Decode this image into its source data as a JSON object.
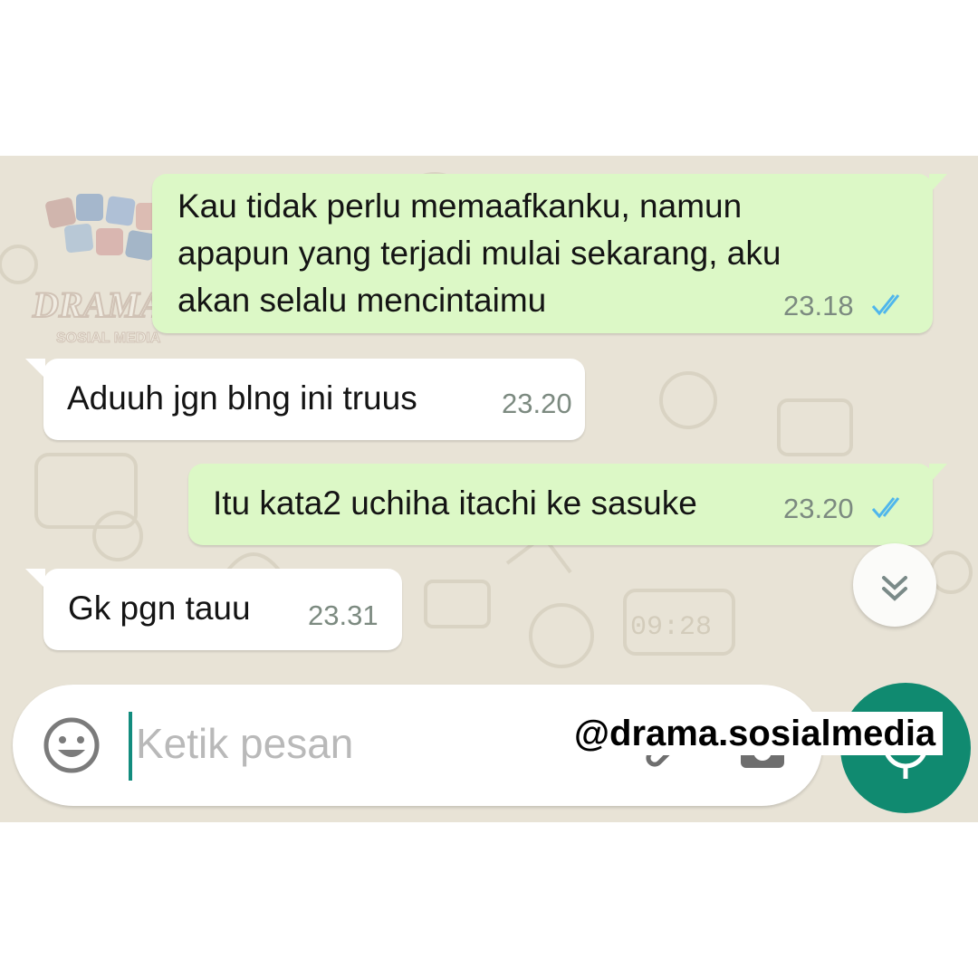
{
  "messages": [
    {
      "direction": "outgoing",
      "text": "Kau tidak perlu memaafkanku, namun\napapun yang terjadi mulai sekarang, aku\nakan selalu mencintaimu",
      "time": "23.18",
      "status": "read"
    },
    {
      "direction": "incoming",
      "text": "Aduuh jgn blng ini truus",
      "time": "23.20"
    },
    {
      "direction": "outgoing",
      "text": "Itu kata2 uchiha itachi ke sasuke",
      "time": "23.20",
      "status": "read"
    },
    {
      "direction": "incoming",
      "text": "Gk pgn tauu",
      "time": "23.31"
    }
  ],
  "input": {
    "placeholder": "Ketik pesan"
  },
  "icons": {
    "emoji": "emoji-icon",
    "attach": "paperclip-icon",
    "camera": "camera-icon",
    "send": "microphone-icon",
    "scroll": "chevron-double-down-icon",
    "read": "double-check-icon"
  },
  "watermark": "@drama.sosialmedia",
  "logo_text": "DRAMA SOSIAL MEDIA",
  "colors": {
    "wallpaper": "#e8e3d6",
    "outgoing_bubble": "#dcf8c6",
    "incoming_bubble": "#ffffff",
    "read_ticks": "#4fb6ec",
    "accent": "#108a70"
  }
}
